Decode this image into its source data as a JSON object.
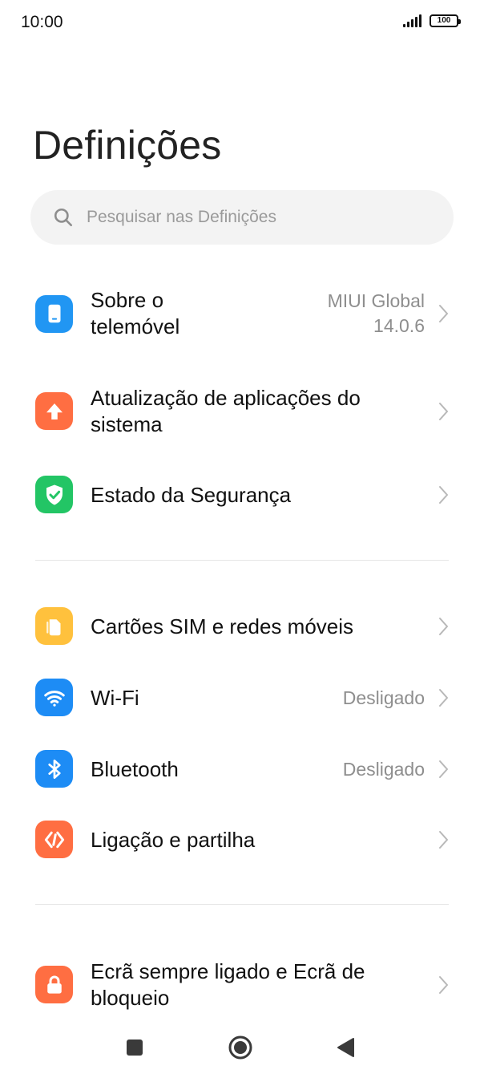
{
  "status": {
    "time": "10:00",
    "battery": "100"
  },
  "header": {
    "title": "Definições"
  },
  "search": {
    "placeholder": "Pesquisar nas Definições"
  },
  "items": [
    {
      "label_line1": "Sobre o",
      "label_line2": "telemóvel",
      "value_line1": "MIUI Global",
      "value_line2": "14.0.6",
      "icon": "phone-icon",
      "color": "#2196f3"
    },
    {
      "label_line1": "Atualização de aplicações do",
      "label_line2": "sistema",
      "icon": "arrow-up-icon",
      "color": "#ff6e42"
    },
    {
      "label": "Estado da Segurança",
      "icon": "shield-check-icon",
      "color": "#23c565"
    },
    {
      "label": "Cartões SIM e redes móveis",
      "icon": "sim-card-icon",
      "color": "#ffc13d"
    },
    {
      "label": "Wi-Fi",
      "value": "Desligado",
      "icon": "wifi-icon",
      "color": "#1d8cf5"
    },
    {
      "label": "Bluetooth",
      "value": "Desligado",
      "icon": "bluetooth-icon",
      "color": "#1d8cf5"
    },
    {
      "label": "Ligação e partilha",
      "icon": "share-connect-icon",
      "color": "#ff6e42"
    },
    {
      "label_line1": "Ecrã sempre ligado e Ecrã de",
      "label_line2": "bloqueio",
      "icon": "lock-icon",
      "color": "#ff6e42"
    }
  ],
  "nav": {
    "recents": "square-icon",
    "home": "circle-icon",
    "back": "triangle-back-icon"
  }
}
